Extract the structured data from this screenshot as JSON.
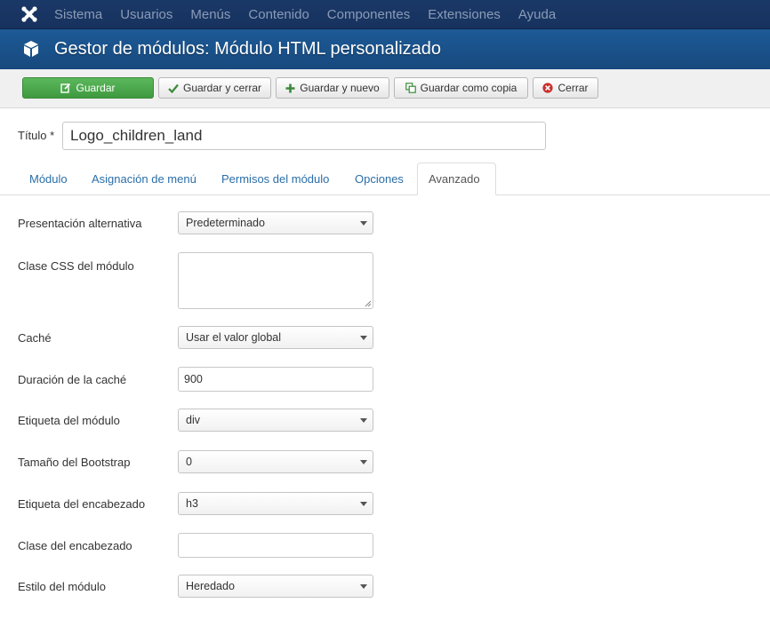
{
  "navbar": {
    "logo_icon": "joomla-logo-icon",
    "menu": [
      "Sistema",
      "Usuarios",
      "Menús",
      "Contenido",
      "Componentes",
      "Extensiones",
      "Ayuda"
    ]
  },
  "header": {
    "icon": "cube-icon",
    "title": "Gestor de módulos: Módulo HTML personalizado"
  },
  "toolbar": {
    "save_label": "Guardar",
    "save_close_label": "Guardar y cerrar",
    "save_new_label": "Guardar y nuevo",
    "save_copy_label": "Guardar como copia",
    "close_label": "Cerrar",
    "colors": {
      "save": "#5cb85c",
      "check": "#3a8a3a",
      "plus": "#3a8a3a",
      "close": "#c9302c"
    }
  },
  "title_field": {
    "label": "Título *",
    "value": "Logo_children_land"
  },
  "tabs": [
    "Módulo",
    "Asignación de menú",
    "Permisos del módulo",
    "Opciones",
    "Avanzado"
  ],
  "active_tab": "Avanzado",
  "form": {
    "layout": {
      "label": "Presentación alternativa",
      "value": "Predeterminado"
    },
    "moduleclass_sfx": {
      "label": "Clase CSS del módulo",
      "value": ""
    },
    "cache": {
      "label": "Caché",
      "value": "Usar el valor global"
    },
    "cache_time": {
      "label": "Duración de la caché",
      "value": "900"
    },
    "module_tag": {
      "label": "Etiqueta del módulo",
      "value": "div"
    },
    "bootstrap_size": {
      "label": "Tamaño del Bootstrap",
      "value": "0"
    },
    "header_tag": {
      "label": "Etiqueta del encabezado",
      "value": "h3"
    },
    "header_class": {
      "label": "Clase del encabezado",
      "value": ""
    },
    "style": {
      "label": "Estilo del módulo",
      "value": "Heredado"
    }
  }
}
